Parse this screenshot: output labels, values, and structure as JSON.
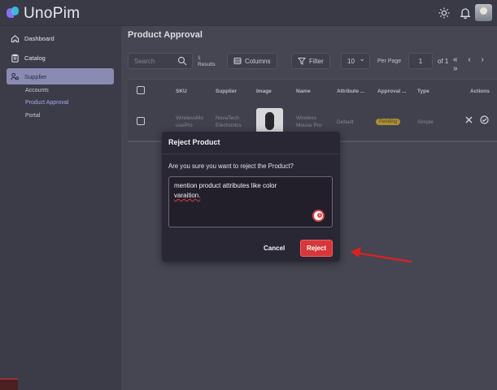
{
  "app": {
    "name": "UnoPim"
  },
  "header": {
    "icons": [
      "sun-icon",
      "bell-icon"
    ],
    "avatar": "user-avatar"
  },
  "sidebar": {
    "items": [
      {
        "label": "Dashboard",
        "icon": "home-icon"
      },
      {
        "label": "Catalog",
        "icon": "clipboard-icon"
      },
      {
        "label": "Supplier",
        "icon": "supplier-icon"
      }
    ],
    "sub_items": [
      {
        "label": "Accounts"
      },
      {
        "label": "Product Approval"
      },
      {
        "label": "Portal"
      }
    ],
    "active_item": "Supplier",
    "active_sub_item": "Product Approval"
  },
  "page": {
    "title": "Product Approval"
  },
  "toolbar": {
    "search_placeholder": "Search",
    "results_count": "1",
    "results_label": "Results",
    "columns_label": "Columns",
    "filter_label": "Filter",
    "per_page_value": "10",
    "per_page_label": "Per Page",
    "page_current": "1",
    "page_of": "of 1",
    "pager_arrows": "« ‹ › »"
  },
  "table": {
    "headers": [
      "SKU",
      "Supplier",
      "Image",
      "Name",
      "Attribute ...",
      "Approval ...",
      "Type",
      "Actions"
    ],
    "rows": [
      {
        "sku": [
          "WirelessMo",
          "usePro"
        ],
        "supplier": [
          "NovaTech",
          "Electronics"
        ],
        "name": [
          "Wireless",
          "Mouse Pro"
        ],
        "attribute": "Default",
        "approval": "Pending",
        "type": "Simple"
      }
    ]
  },
  "modal": {
    "title": "Reject Product",
    "question": "Are you sure you want to reject the Product?",
    "textarea_line1": "mention product attributes like color",
    "textarea_line2": "varaition.",
    "grammar_badge": "1",
    "cancel_label": "Cancel",
    "reject_label": "Reject"
  },
  "colors": {
    "accent": "#8a8ab2",
    "danger": "#d6373b",
    "pending": "#b89a3a",
    "annotation_arrow": "#e02020"
  }
}
